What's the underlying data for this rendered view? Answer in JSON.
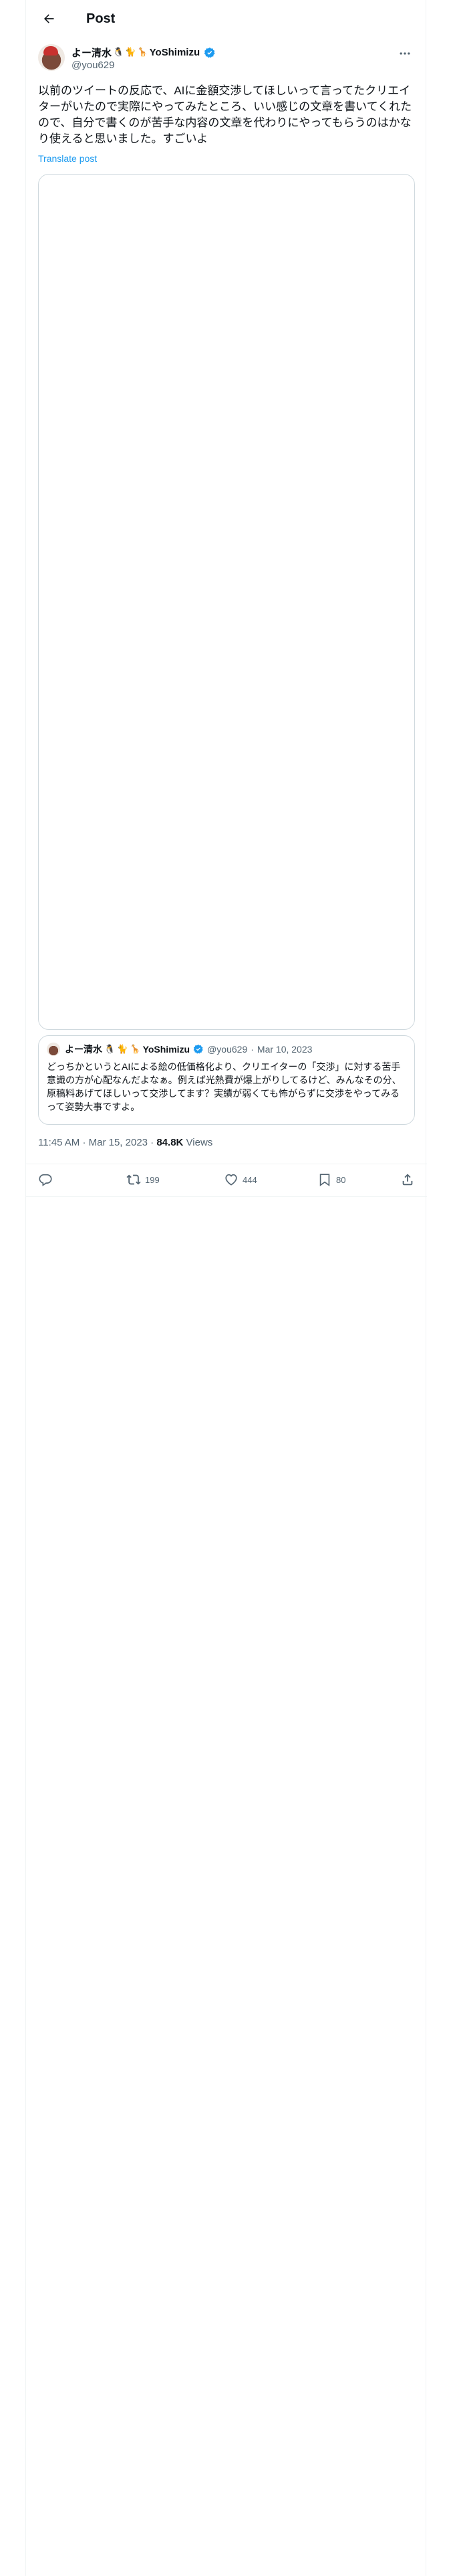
{
  "header": {
    "title": "Post"
  },
  "author": {
    "name": "よー清水",
    "emojis": [
      "🐧",
      "🐈",
      "🦒"
    ],
    "name_suffix": "YoShimizu",
    "handle": "@you629"
  },
  "tweet": {
    "text": "以前のツイートの反応で、AIに金額交渉してほしいって言ってたクリエイターがいたので実際にやってみたところ、いい感じの文章を書いてくれたので、自分で書くのが苦手な内容の文章を代わりにやってもらうのはかなり使えると思いました。すごいよ",
    "translate_label": "Translate post"
  },
  "quote": {
    "name": "よー清水",
    "emojis": [
      "🐧",
      "🐈",
      "🦒"
    ],
    "name_suffix": "YoShimizu",
    "handle": "@you629",
    "date": "Mar 10, 2023",
    "text": "どっちかというとAIによる絵の低価格化より、クリエイターの「交渉」に対する苦手意識の方が心配なんだよなぁ。例えば光熱費が爆上がりしてるけど、みんなその分、原稿料あげてほしいって交渉してます？実績が弱くても怖がらずに交渉をやってみるって姿勢大事ですよ。"
  },
  "meta": {
    "time": "11:45 AM",
    "date": "Mar 15, 2023",
    "views_count": "84.8K",
    "views_label": "Views"
  },
  "actions": {
    "retweets": "199",
    "likes": "444",
    "bookmarks": "80"
  },
  "colors": {
    "accent": "#1d9bf0",
    "secondary_text": "#536471",
    "border": "#cfd9de"
  }
}
